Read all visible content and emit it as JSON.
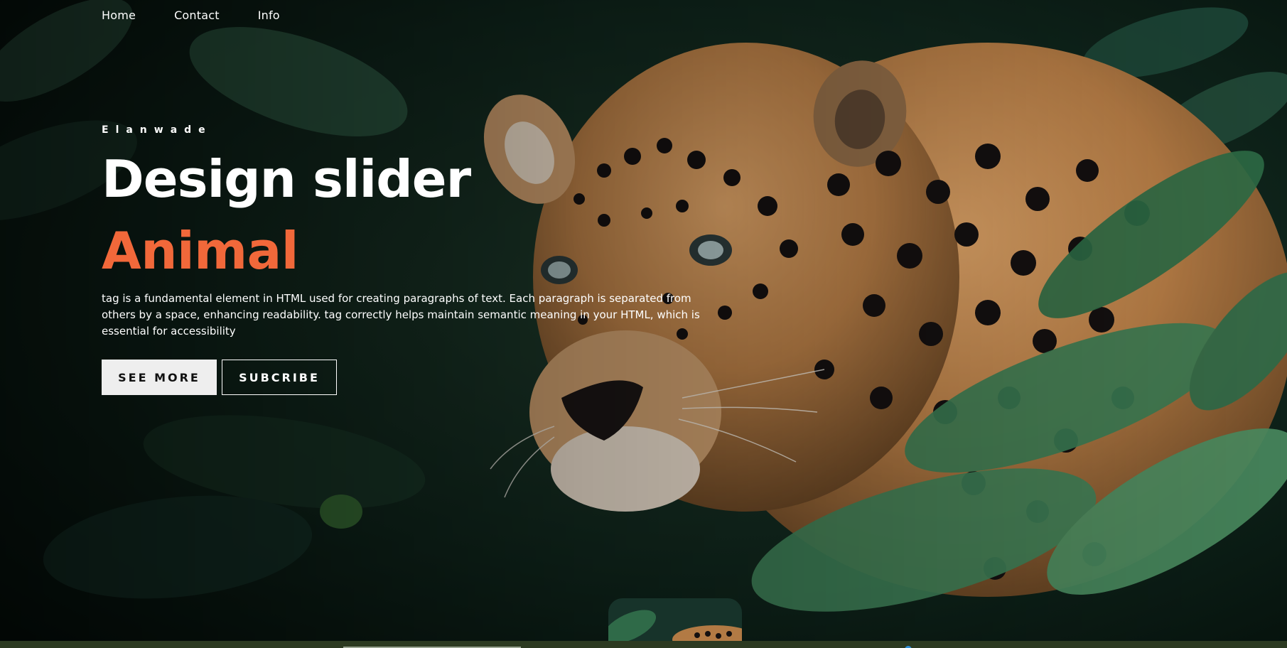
{
  "nav": {
    "items": [
      {
        "label": "Home"
      },
      {
        "label": "Contact"
      },
      {
        "label": "Info"
      }
    ]
  },
  "slide": {
    "author": "Elanwade",
    "title": "Design slider",
    "topic": "Animal",
    "description": "tag is a fundamental element in HTML used for creating paragraphs of text. Each paragraph is separated from others by a space, enhancing readability. tag correctly helps maintain semantic meaning in your HTML, which is essential for accessibility",
    "buttons": {
      "see_more": "SEE MORE",
      "subscribe": "SUBCRIBE"
    }
  },
  "colors": {
    "accent": "#f1683a",
    "text": "#ffffff",
    "primary_button_bg": "#eeeeee",
    "background": "#0a1712"
  },
  "icons": {
    "background_image": "jaguar-in-jungle-image",
    "thumbnail_image": "jaguar-thumbnail-image"
  }
}
